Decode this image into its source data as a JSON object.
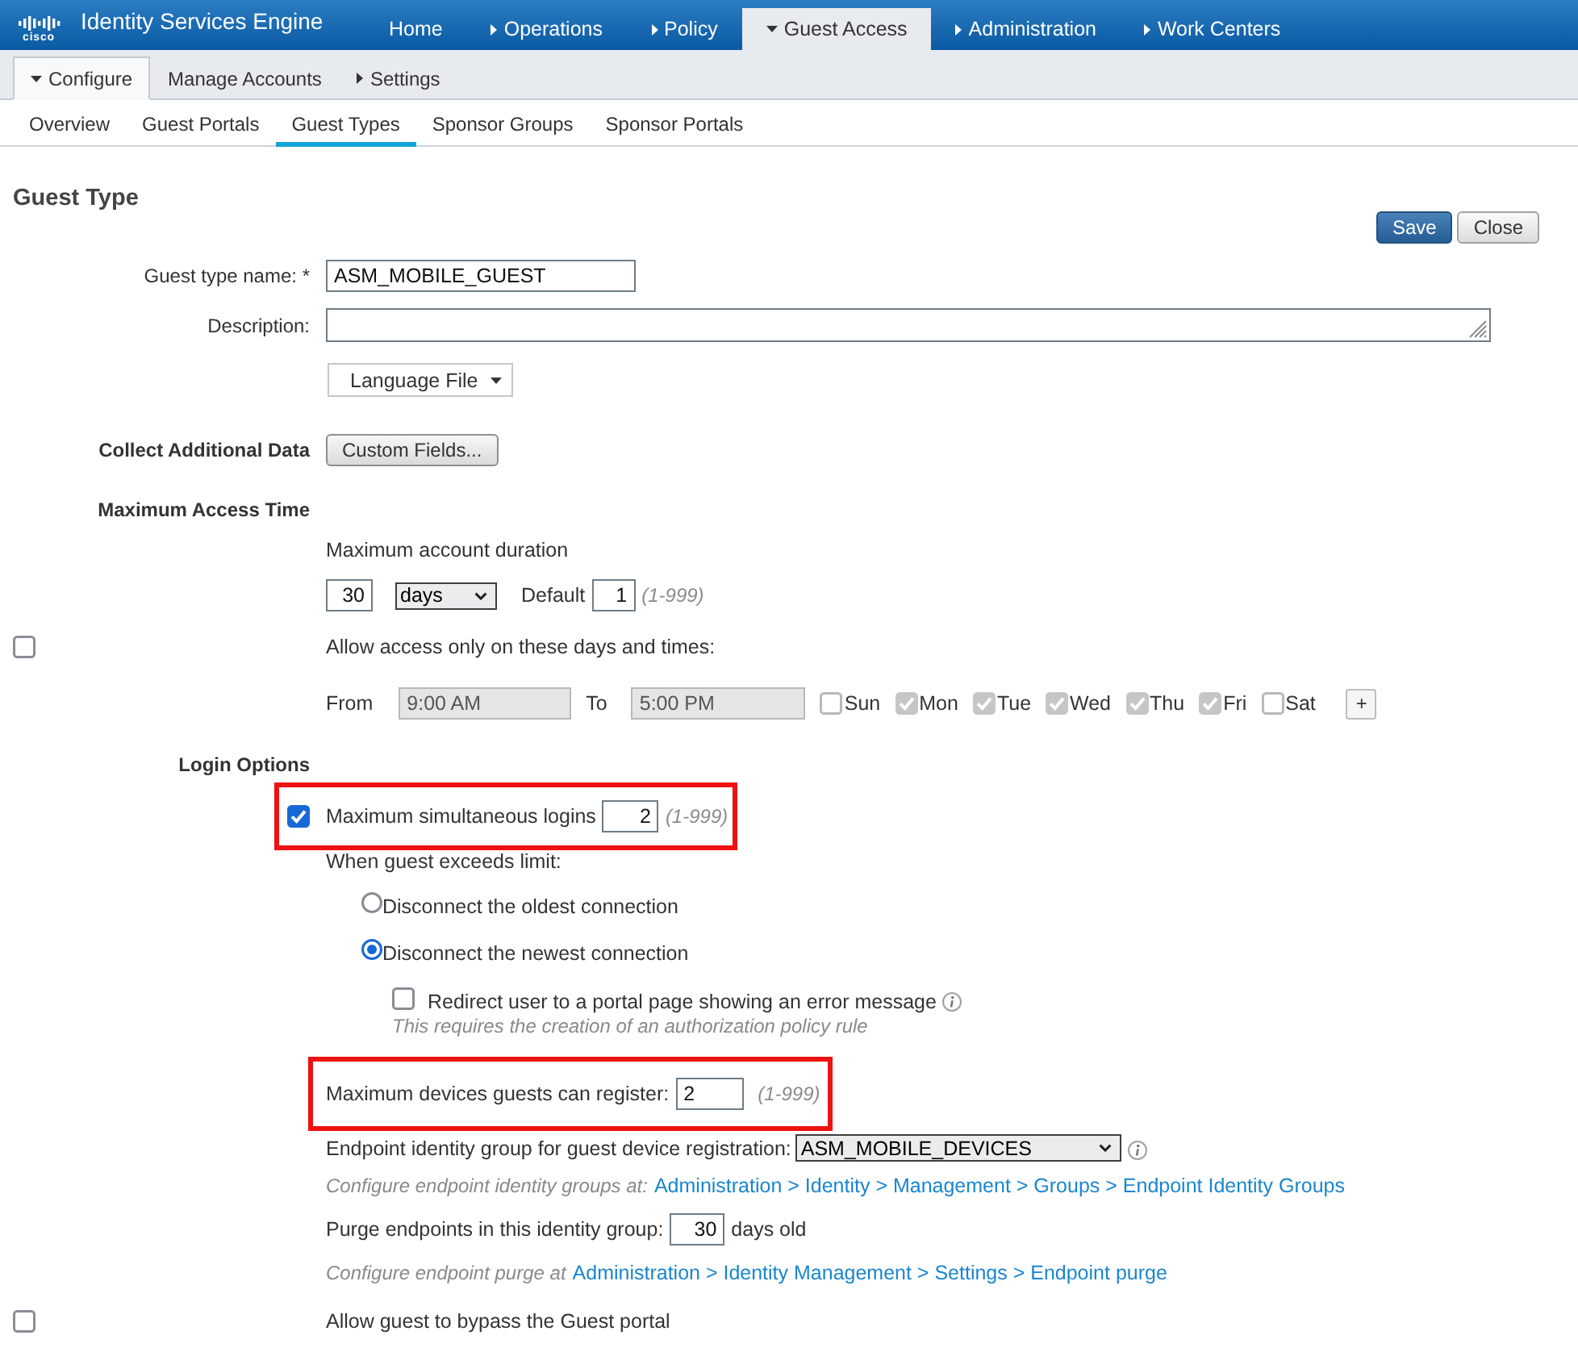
{
  "header": {
    "logo_text": "cisco",
    "title": "Identity Services Engine"
  },
  "main_nav": [
    {
      "label": "Home",
      "has_menu": false,
      "selected": false
    },
    {
      "label": "Operations",
      "has_menu": true,
      "selected": false
    },
    {
      "label": "Policy",
      "has_menu": true,
      "selected": false
    },
    {
      "label": "Guest Access",
      "has_menu": true,
      "selected": true
    },
    {
      "label": "Administration",
      "has_menu": true,
      "selected": false
    },
    {
      "label": "Work Centers",
      "has_menu": true,
      "selected": false
    }
  ],
  "sub_nav": [
    {
      "label": "Configure",
      "has_menu": true,
      "selected": true
    },
    {
      "label": "Manage Accounts",
      "has_menu": false,
      "selected": false
    },
    {
      "label": "Settings",
      "has_menu": true,
      "selected": false
    }
  ],
  "tabs": [
    {
      "label": "Overview",
      "selected": false
    },
    {
      "label": "Guest Portals",
      "selected": false
    },
    {
      "label": "Guest Types",
      "selected": true
    },
    {
      "label": "Sponsor Groups",
      "selected": false
    },
    {
      "label": "Sponsor Portals",
      "selected": false
    }
  ],
  "page": {
    "title": "Guest Type",
    "buttons": [
      {
        "label": "Save",
        "kind": "primary"
      },
      {
        "label": "Close",
        "kind": "secondary"
      }
    ]
  },
  "general": {
    "name": {
      "label": "Guest type name: *",
      "value": "ASM_MOBILE_GUEST"
    },
    "description": {
      "label": "Description:"
    },
    "language_button": "Language File",
    "collect_label": "Collect Additional Data",
    "custom_fields_button": "Custom Fields..."
  },
  "access_time": {
    "label": "Maximum Access Time",
    "duration_label": "Maximum account duration",
    "duration": "30",
    "unit": "days",
    "default_label": "Default",
    "default": "1",
    "range": "(1-999)",
    "restrict": {
      "label": "Allow access only on these days and times:",
      "checked": false
    },
    "schedule": {
      "disabled": true,
      "from_label": "From",
      "from": "9:00 AM",
      "to_label": "To",
      "to": "5:00 PM",
      "days": [
        {
          "label": "Sun",
          "checked": false
        },
        {
          "label": "Mon",
          "checked": true
        },
        {
          "label": "Tue",
          "checked": true
        },
        {
          "label": "Wed",
          "checked": true
        },
        {
          "label": "Thu",
          "checked": true
        },
        {
          "label": "Fri",
          "checked": true
        },
        {
          "label": "Sat",
          "checked": false
        }
      ],
      "add_button": "+"
    }
  },
  "login_options": {
    "label": "Login Options",
    "max_logins": {
      "label": "Maximum simultaneous logins",
      "checked": true,
      "value": "2",
      "range": "(1-999)",
      "highlighted": true
    },
    "exceed_label": "When guest exceeds limit:",
    "exceed_actions": [
      {
        "label": "Disconnect the oldest connection",
        "selected": false
      },
      {
        "label": "Disconnect the newest connection",
        "selected": true
      }
    ],
    "redirect": {
      "label": "Redirect user to a portal page showing an error message",
      "checked": false,
      "note": "This requires the creation of an authorization policy rule"
    },
    "max_devices": {
      "label": "Maximum devices guests can register:",
      "value": "2",
      "range": "(1-999)",
      "highlighted": true
    },
    "endpoint_group": {
      "label": "Endpoint identity group for guest device registration:",
      "value": "ASM_MOBILE_DEVICES"
    },
    "endpoint_group_hint": {
      "text": "Configure endpoint identity groups at:",
      "link": "Administration > Identity > Management > Groups > Endpoint Identity Groups"
    },
    "purge": {
      "label": "Purge endpoints in this identity group:",
      "value": "30",
      "suffix": "days old"
    },
    "purge_hint": {
      "text": "Configure endpoint purge at",
      "link": "Administration > Identity Management > Settings > Endpoint purge"
    },
    "bypass": {
      "label": "Allow guest to bypass the Guest portal",
      "checked": false
    }
  }
}
